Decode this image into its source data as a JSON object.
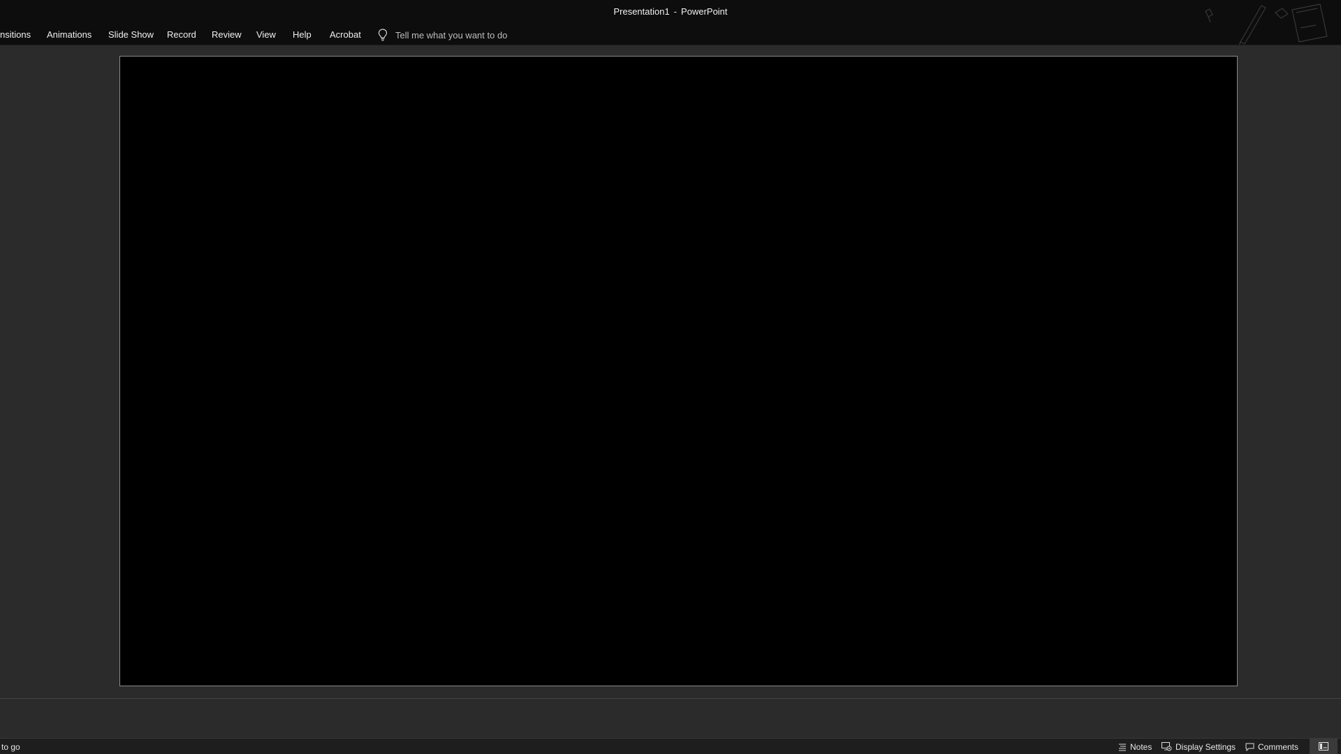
{
  "window": {
    "doc_name": "Presentation1",
    "separator": "-",
    "app_name": "PowerPoint"
  },
  "ribbon": {
    "tabs": [
      {
        "label": "nsitions"
      },
      {
        "label": "Animations"
      },
      {
        "label": "Slide Show"
      },
      {
        "label": "Record"
      },
      {
        "label": "Review"
      },
      {
        "label": "View"
      },
      {
        "label": "Help"
      },
      {
        "label": "Acrobat"
      }
    ],
    "tell_me": {
      "icon": "lightbulb-icon",
      "text": "Tell me what you want to do"
    }
  },
  "status_bar": {
    "left_text": "to go",
    "notes_label": "Notes",
    "display_settings_label": "Display Settings",
    "comments_label": "Comments"
  },
  "colors": {
    "title_bar": "#0d0d0d",
    "canvas_bg": "#2b2b2b",
    "slide_bg": "#000000",
    "status_bar": "#1e1e1e"
  }
}
